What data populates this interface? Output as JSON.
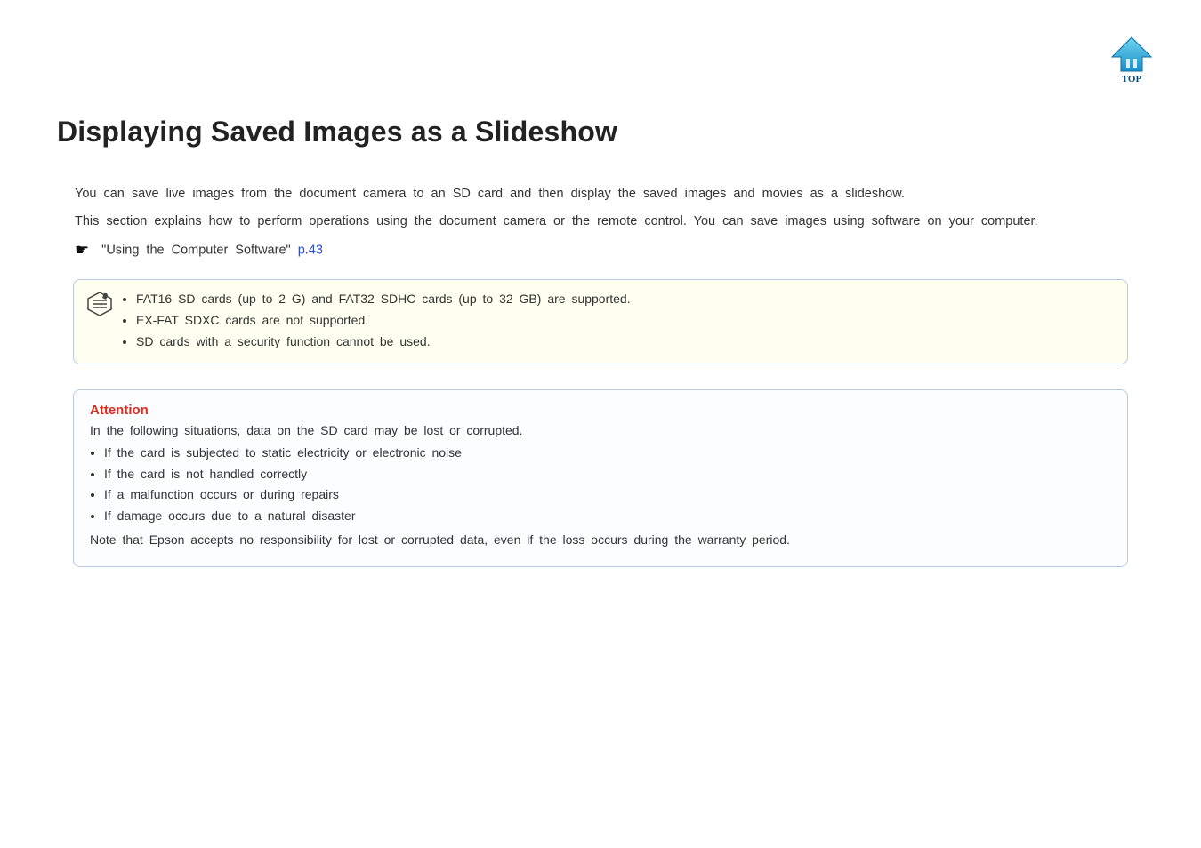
{
  "header": {
    "top_label": "TOP"
  },
  "title": "Displaying Saved Images as a Slideshow",
  "intro": {
    "p1": "You can save live images from the document camera to an SD card and then display the saved images and movies as a slideshow.",
    "p2": "This section explains how to perform operations using the document camera or the remote control. You can save images using software on your computer."
  },
  "see_also": {
    "text": "\"Using the Computer Software\" ",
    "link": "p.43"
  },
  "note": {
    "items": [
      "FAT16 SD cards (up to 2 G) and FAT32 SDHC cards (up to 32 GB) are supported.",
      "EX-FAT SDXC cards are not supported.",
      "SD cards with a security function cannot be used."
    ]
  },
  "attention": {
    "title": "Attention",
    "lead": "In the following situations, data on the SD card may be lost or corrupted.",
    "items": [
      "If the card is subjected to static electricity or electronic noise",
      "If the card is not handled correctly",
      "If a malfunction occurs or during repairs",
      "If damage occurs due to a natural disaster"
    ],
    "tail": "Note that Epson accepts no responsibility for lost or corrupted data, even if the loss occurs during the warranty period."
  }
}
